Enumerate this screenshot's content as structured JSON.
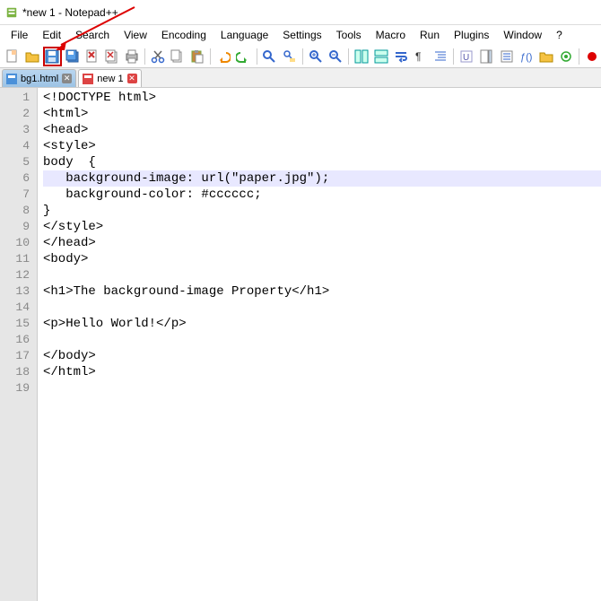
{
  "title": "*new 1 - Notepad++",
  "menu": {
    "file": "File",
    "edit": "Edit",
    "search": "Search",
    "view": "View",
    "encoding": "Encoding",
    "language": "Language",
    "settings": "Settings",
    "tools": "Tools",
    "macro": "Macro",
    "run": "Run",
    "plugins": "Plugins",
    "window": "Window",
    "help": "?"
  },
  "tabs": [
    {
      "label": "bg1.html",
      "modified": false,
      "active": false
    },
    {
      "label": "new 1",
      "modified": true,
      "active": true
    }
  ],
  "toolbar_icons": {
    "new": "new-icon",
    "open": "open-icon",
    "save": "save-icon",
    "saveall": "save-all-icon",
    "close": "close-icon",
    "closeall": "close-all-icon",
    "print": "print-icon",
    "cut": "cut-icon",
    "copy": "copy-icon",
    "paste": "paste-icon",
    "undo": "undo-icon",
    "redo": "redo-icon",
    "find": "find-icon",
    "replace": "replace-icon",
    "zoomin": "zoom-in-icon",
    "zoomout": "zoom-out-icon",
    "sync": "sync-icon",
    "wrap": "wrap-icon",
    "allchars": "allchars-icon",
    "indent": "indent-icon",
    "userdef": "userdef-icon",
    "docmap": "docmap-icon",
    "funclist": "funclist-icon",
    "folder": "folder-icon",
    "monitor": "monitor-icon",
    "record": "record-icon"
  },
  "editor": {
    "current_line": 6,
    "lines": [
      "<!DOCTYPE html>",
      "<html>",
      "<head>",
      "<style>",
      "body  {",
      "   background-image: url(\"paper.jpg\");",
      "   background-color: #cccccc;",
      "}",
      "</style>",
      "</head>",
      "<body>",
      "",
      "<h1>The background-image Property</h1>",
      "",
      "<p>Hello World!</p>",
      "",
      "</body>",
      "</html>",
      ""
    ]
  }
}
